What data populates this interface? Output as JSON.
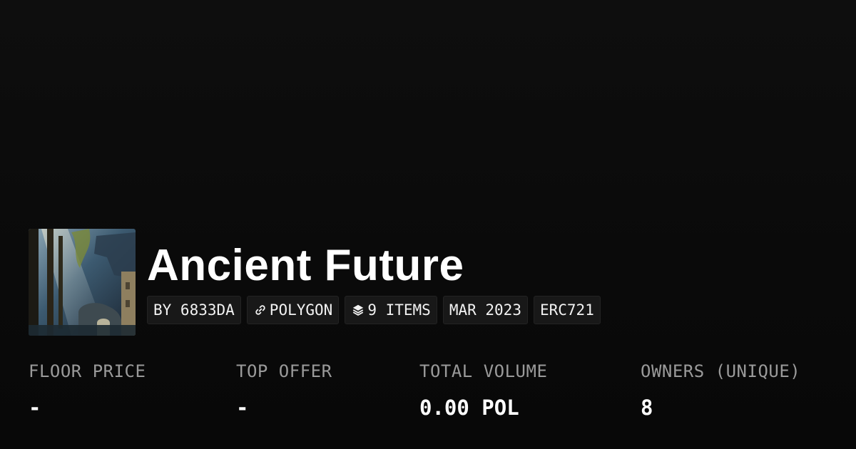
{
  "collection": {
    "title": "Ancient Future",
    "thumbnail_icon": "collection-artwork-image"
  },
  "badges": {
    "creator": "BY 6833DA",
    "chain": "POLYGON",
    "chain_icon": "link-icon",
    "items": "9 ITEMS",
    "items_icon": "layers-icon",
    "date": "MAR 2023",
    "standard": "ERC721"
  },
  "stats": [
    {
      "label": "FLOOR PRICE",
      "value": "-"
    },
    {
      "label": "TOP OFFER",
      "value": "-"
    },
    {
      "label": "TOTAL VOLUME",
      "value": "0.00 POL"
    },
    {
      "label": "OWNERS (UNIQUE)",
      "value": "8"
    }
  ]
}
